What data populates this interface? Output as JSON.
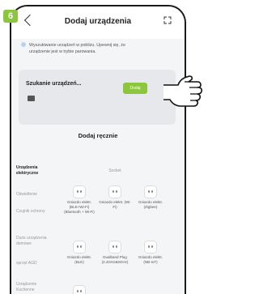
{
  "step_badge": "6",
  "header": {
    "title": "Dodaj urządzenia"
  },
  "notice": {
    "line1": "Wyszukiwanie urządzeń w pobliżu. Upewnij się, że",
    "line2": "urządzenie jest w trybie parowania."
  },
  "search_card": {
    "title": "Szukanie urządzeń...",
    "add_label": "Dodaj"
  },
  "manual": {
    "title": "Dodaj ręcznie"
  },
  "categories": [
    "Urządzenia elektryczne",
    "Oświetlenie",
    "Czujnik ochrony",
    "Duże urządzenia domowe",
    "sprzęt AGD",
    "Urządzenie Kuchenne"
  ],
  "columns": {
    "socket": "Socket"
  },
  "devices": [
    {
      "label": "Gniazdo elektr. (BLE+Wi-Fi) (Bluetooth + Wi-Fi)"
    },
    {
      "label": "Gniazdo elektr. (Wi-Fi)"
    },
    {
      "label": "Gniazdo elektr. (Zigbee)"
    },
    {
      "label": "Gniazdo elektr. (BLE)"
    },
    {
      "label": "Dualband Plug (2.4GHz&5GHz)"
    },
    {
      "label": "Gniazdo elektr. (NB-IoT)"
    }
  ],
  "colors": {
    "accent": "#8cc63f"
  }
}
